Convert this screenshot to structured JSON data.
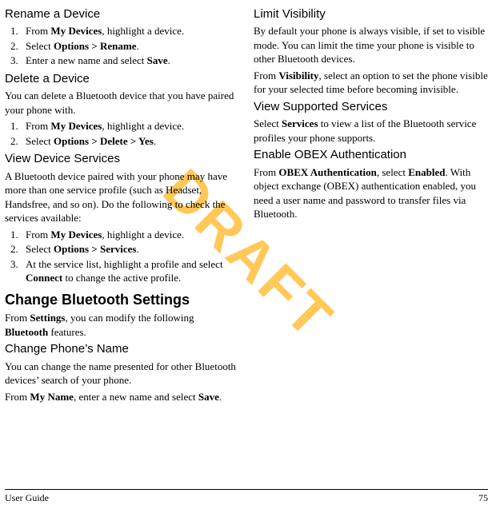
{
  "watermark": "DRAFT",
  "left": {
    "s1": {
      "h": "Rename a Device",
      "o1a": "From ",
      "o1b": "My Devices",
      "o1c": ", highlight a device.",
      "o2a": "Select ",
      "o2b": "Options > Rename",
      "o2c": ".",
      "o3a": "Enter a new name and select ",
      "o3b": "Save",
      "o3c": "."
    },
    "s2": {
      "h": "Delete a Device",
      "p": "You can delete a Bluetooth device that you have paired your phone with.",
      "o1a": "From ",
      "o1b": "My Devices",
      "o1c": ", highlight a device.",
      "o2a": "Select ",
      "o2b": "Options > Delete > Yes",
      "o2c": "."
    },
    "s3": {
      "h": "View Device Services",
      "p": "A Bluetooth device paired with your phone may have more than one service profile (such as Headset, Handsfree, and so on). Do the following to check the services available:",
      "o1a": "From ",
      "o1b": "My Devices",
      "o1c": ", highlight a device.",
      "o2a": "Select ",
      "o2b": "Options > Services",
      "o2c": ".",
      "o3a": "At the service list, highlight a profile and select ",
      "o3b": "Connect",
      "o3c": " to change the active profile."
    },
    "s4": {
      "h": "Change Bluetooth Settings",
      "pa": "From ",
      "pb": "Settings",
      "pc": ", you can modify the following ",
      "pd": "Bluetooth",
      "pe": " features."
    },
    "s5": {
      "h": "Change Phone’s Name",
      "p1": "You can change the name presented for other Bluetooth devices’ search of your phone.",
      "p2a": "From ",
      "p2b": "My Name",
      "p2c": ", enter a new name and select ",
      "p2d": "Save",
      "p2e": "."
    }
  },
  "right": {
    "s1": {
      "h": "Limit Visibility",
      "p1": "By default your phone is always visible, if set to visible mode. You can limit the time your phone is visible to other Bluetooth devices.",
      "p2a": "From ",
      "p2b": "Visibility",
      "p2c": ", select an option to set the phone visible for your selected time before becoming invisible."
    },
    "s2": {
      "h": "View Supported Services",
      "pa": "Select ",
      "pb": "Services",
      "pc": " to view a list of the Bluetooth service profiles your phone supports."
    },
    "s3": {
      "h": "Enable OBEX Authentication",
      "pa": "From ",
      "pb": "OBEX Authentication",
      "pc": ", select ",
      "pd": "Enabled",
      "pe": ". With object exchange (OBEX) authentication enabled, you need a user name and password to transfer files via Bluetooth."
    }
  },
  "footer": {
    "left": "User Guide",
    "right": "75"
  }
}
